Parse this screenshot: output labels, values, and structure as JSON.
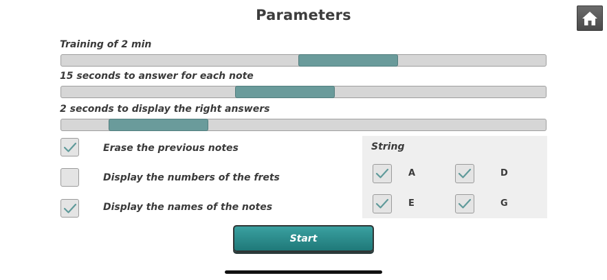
{
  "title": "Parameters",
  "home": {
    "icon": "home-icon"
  },
  "sliders": [
    {
      "label": "Training of 2 min",
      "level": 0.59
    },
    {
      "label": "15 seconds to answer for each note",
      "level": 0.46
    },
    {
      "label": "2 seconds to display the right answers",
      "level": 0.2
    }
  ],
  "options": [
    {
      "label": "Erase the previous notes",
      "checked": true
    },
    {
      "label": "Display the numbers of the frets",
      "checked": false
    },
    {
      "label": "Display the names of the notes",
      "checked": true
    }
  ],
  "strings": {
    "title": "String",
    "items": [
      {
        "label": "A",
        "checked": true
      },
      {
        "label": "D",
        "checked": true
      },
      {
        "label": "E",
        "checked": true
      },
      {
        "label": "G",
        "checked": true
      }
    ]
  },
  "start_label": "Start",
  "colors": {
    "accent": "#2a8c8c",
    "slider_thumb": "#6a9b9b",
    "check": "#5f9a9a"
  }
}
